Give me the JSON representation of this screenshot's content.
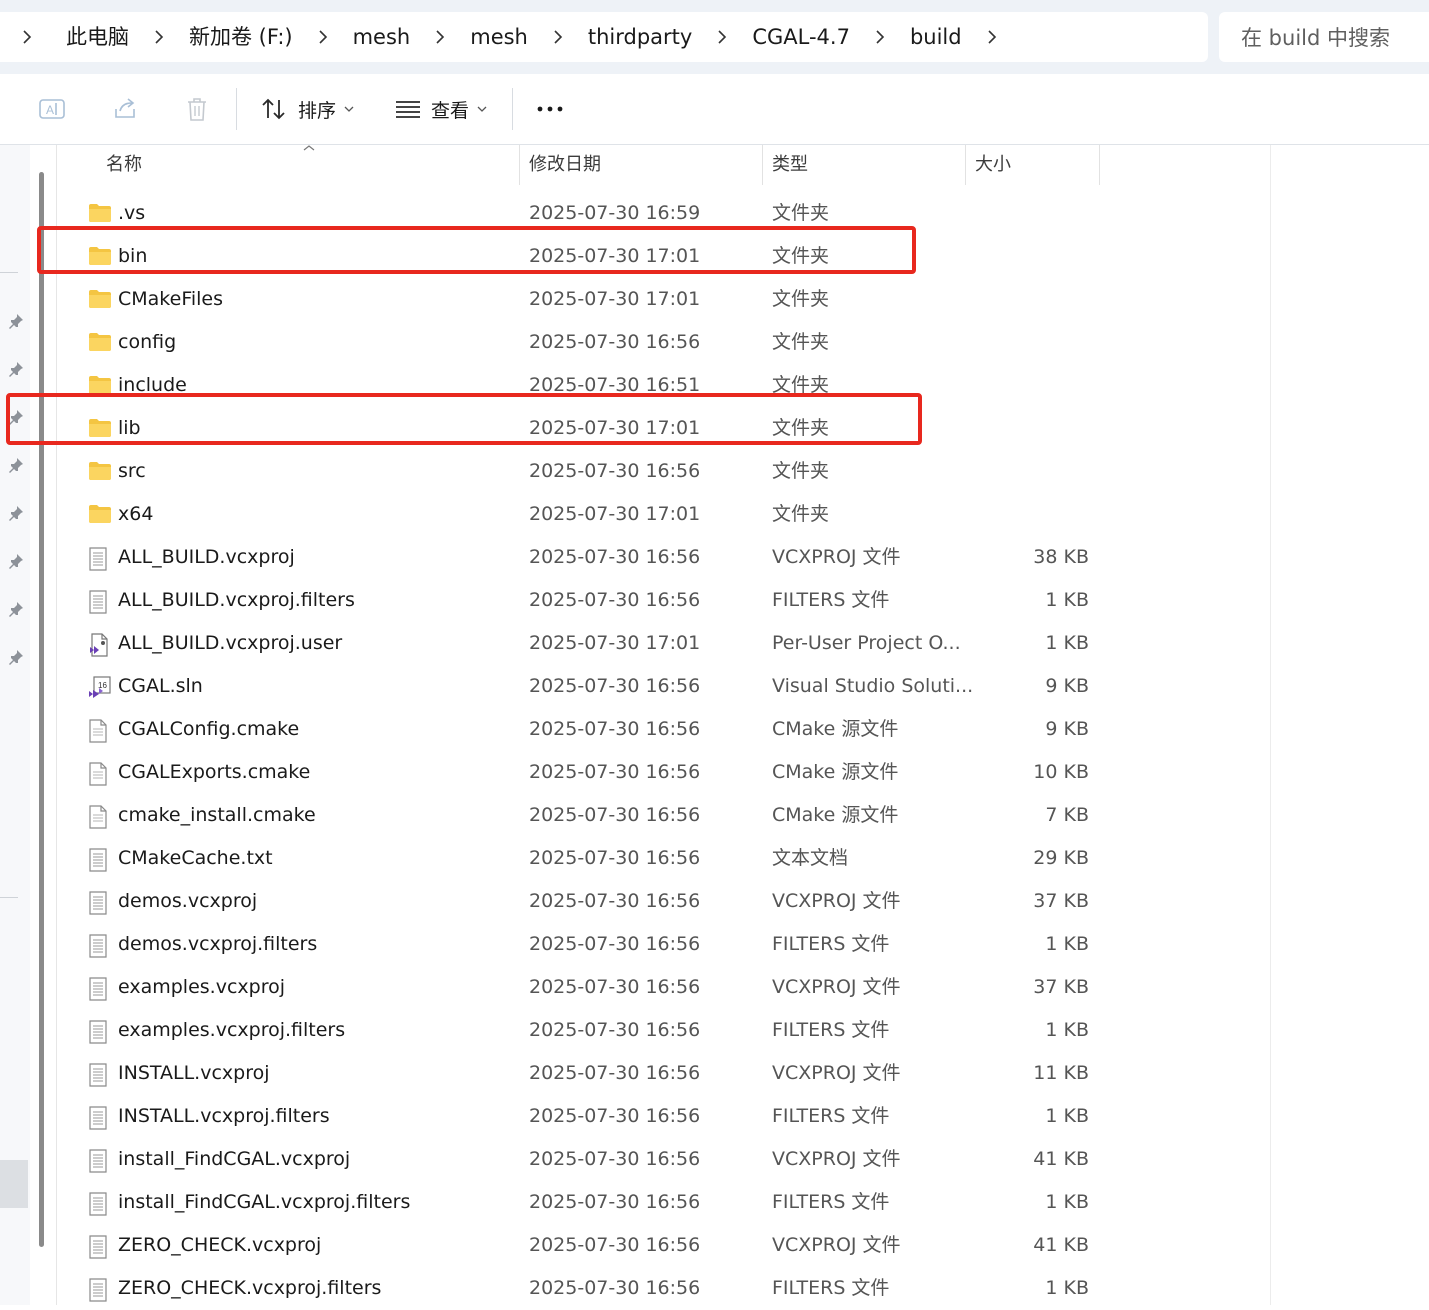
{
  "address": {
    "crumbs": [
      "此电脑",
      "新加卷 (F:)",
      "mesh",
      "mesh",
      "thirdparty",
      "CGAL-4.7",
      "build"
    ],
    "search_placeholder": "在 build 中搜索"
  },
  "toolbar": {
    "sort_label": "排序",
    "view_label": "查看",
    "more_label": "..."
  },
  "columns": {
    "name": "名称",
    "date": "修改日期",
    "type": "类型",
    "size": "大小"
  },
  "files": [
    {
      "name": ".vs",
      "date": "2025-07-30 16:59",
      "type": "文件夹",
      "size": "",
      "icon": "folder-icon",
      "highlighted": false
    },
    {
      "name": "bin",
      "date": "2025-07-30 17:01",
      "type": "文件夹",
      "size": "",
      "icon": "folder-icon",
      "highlighted": true
    },
    {
      "name": "CMakeFiles",
      "date": "2025-07-30 17:01",
      "type": "文件夹",
      "size": "",
      "icon": "folder-icon",
      "highlighted": false
    },
    {
      "name": "config",
      "date": "2025-07-30 16:56",
      "type": "文件夹",
      "size": "",
      "icon": "folder-icon",
      "highlighted": false
    },
    {
      "name": "include",
      "date": "2025-07-30 16:51",
      "type": "文件夹",
      "size": "",
      "icon": "folder-icon",
      "highlighted": false
    },
    {
      "name": "lib",
      "date": "2025-07-30 17:01",
      "type": "文件夹",
      "size": "",
      "icon": "folder-icon",
      "highlighted": true
    },
    {
      "name": "src",
      "date": "2025-07-30 16:56",
      "type": "文件夹",
      "size": "",
      "icon": "folder-icon",
      "highlighted": false
    },
    {
      "name": "x64",
      "date": "2025-07-30 17:01",
      "type": "文件夹",
      "size": "",
      "icon": "folder-icon",
      "highlighted": false
    },
    {
      "name": "ALL_BUILD.vcxproj",
      "date": "2025-07-30 16:56",
      "type": "VCXPROJ 文件",
      "size": "38 KB",
      "icon": "file-icon",
      "highlighted": false
    },
    {
      "name": "ALL_BUILD.vcxproj.filters",
      "date": "2025-07-30 16:56",
      "type": "FILTERS 文件",
      "size": "1 KB",
      "icon": "file-icon",
      "highlighted": false
    },
    {
      "name": "ALL_BUILD.vcxproj.user",
      "date": "2025-07-30 17:01",
      "type": "Per-User Project O...",
      "size": "1 KB",
      "icon": "vs-user-file-icon",
      "highlighted": false
    },
    {
      "name": "CGAL.sln",
      "date": "2025-07-30 16:56",
      "type": "Visual Studio Soluti...",
      "size": "9 KB",
      "icon": "vs-solution-icon",
      "highlighted": false
    },
    {
      "name": "CGALConfig.cmake",
      "date": "2025-07-30 16:56",
      "type": "CMake 源文件",
      "size": "9 KB",
      "icon": "text-file-icon",
      "highlighted": false
    },
    {
      "name": "CGALExports.cmake",
      "date": "2025-07-30 16:56",
      "type": "CMake 源文件",
      "size": "10 KB",
      "icon": "text-file-icon",
      "highlighted": false
    },
    {
      "name": "cmake_install.cmake",
      "date": "2025-07-30 16:56",
      "type": "CMake 源文件",
      "size": "7 KB",
      "icon": "text-file-icon",
      "highlighted": false
    },
    {
      "name": "CMakeCache.txt",
      "date": "2025-07-30 16:56",
      "type": "文本文档",
      "size": "29 KB",
      "icon": "file-icon",
      "highlighted": false
    },
    {
      "name": "demos.vcxproj",
      "date": "2025-07-30 16:56",
      "type": "VCXPROJ 文件",
      "size": "37 KB",
      "icon": "file-icon",
      "highlighted": false
    },
    {
      "name": "demos.vcxproj.filters",
      "date": "2025-07-30 16:56",
      "type": "FILTERS 文件",
      "size": "1 KB",
      "icon": "file-icon",
      "highlighted": false
    },
    {
      "name": "examples.vcxproj",
      "date": "2025-07-30 16:56",
      "type": "VCXPROJ 文件",
      "size": "37 KB",
      "icon": "file-icon",
      "highlighted": false
    },
    {
      "name": "examples.vcxproj.filters",
      "date": "2025-07-30 16:56",
      "type": "FILTERS 文件",
      "size": "1 KB",
      "icon": "file-icon",
      "highlighted": false
    },
    {
      "name": "INSTALL.vcxproj",
      "date": "2025-07-30 16:56",
      "type": "VCXPROJ 文件",
      "size": "11 KB",
      "icon": "file-icon",
      "highlighted": false
    },
    {
      "name": "INSTALL.vcxproj.filters",
      "date": "2025-07-30 16:56",
      "type": "FILTERS 文件",
      "size": "1 KB",
      "icon": "file-icon",
      "highlighted": false
    },
    {
      "name": "install_FindCGAL.vcxproj",
      "date": "2025-07-30 16:56",
      "type": "VCXPROJ 文件",
      "size": "41 KB",
      "icon": "file-icon",
      "highlighted": false
    },
    {
      "name": "install_FindCGAL.vcxproj.filters",
      "date": "2025-07-30 16:56",
      "type": "FILTERS 文件",
      "size": "1 KB",
      "icon": "file-icon",
      "highlighted": false
    },
    {
      "name": "ZERO_CHECK.vcxproj",
      "date": "2025-07-30 16:56",
      "type": "VCXPROJ 文件",
      "size": "41 KB",
      "icon": "file-icon",
      "highlighted": false
    },
    {
      "name": "ZERO_CHECK.vcxproj.filters",
      "date": "2025-07-30 16:56",
      "type": "FILTERS 文件",
      "size": "1 KB",
      "icon": "file-icon",
      "highlighted": false
    }
  ],
  "colors": {
    "highlight_box": "#e8281e",
    "folder": "#f4c542",
    "accent": "#005fb8"
  }
}
